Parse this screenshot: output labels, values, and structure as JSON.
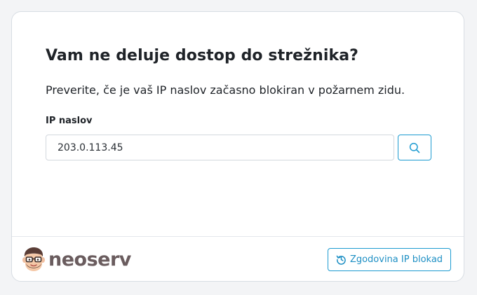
{
  "dialog": {
    "title": "Vam ne deluje dostop do strežnika?",
    "subtitle": "Preverite, če je vaš IP naslov začasno blokiran v požarnem zidu.",
    "ip_label": "IP naslov",
    "ip_value": "203.0.113.45",
    "search_icon": "search-icon"
  },
  "footer": {
    "logo_text": "neoserv",
    "logo_icon": "mascot-face-icon",
    "history_button_label": "Zgodovina IP blokad",
    "history_icon": "history-icon"
  },
  "colors": {
    "accent": "#1d9bd1",
    "logo_text": "#6a5c5e",
    "title": "#1f2328"
  }
}
